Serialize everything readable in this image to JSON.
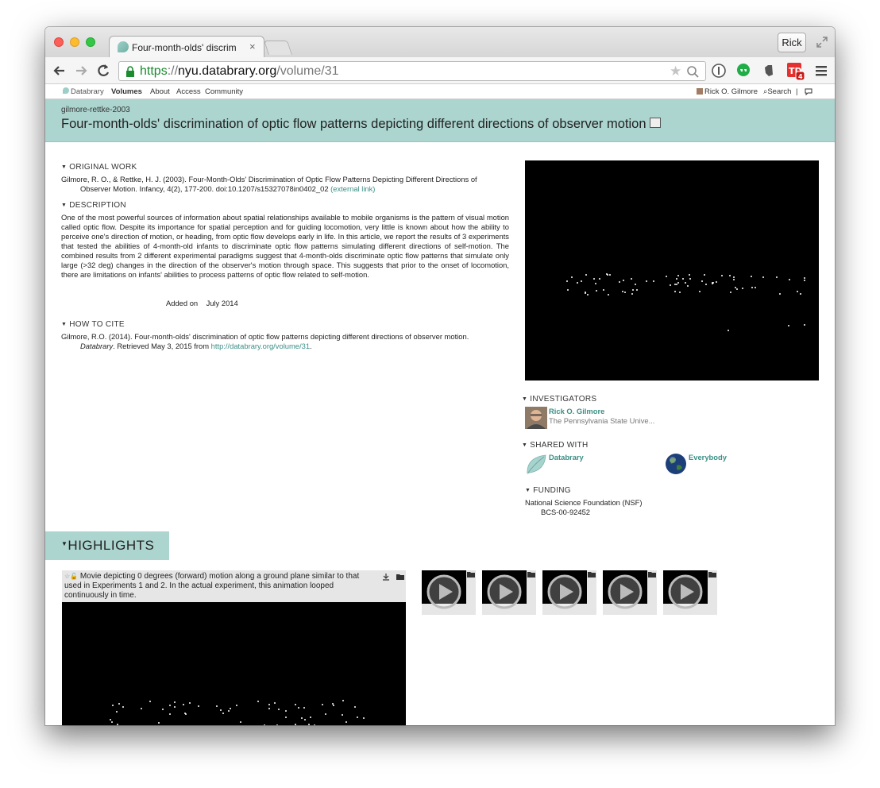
{
  "browser": {
    "tab_title": "Four-month-olds' discrim",
    "tab_close": "×",
    "user_label": "Rick",
    "url_scheme": "https",
    "url_sep": "://",
    "url_host": "nyu.databrary.org",
    "url_path": "/volume/31",
    "badge_count": "4",
    "ext_td_label": "TD"
  },
  "sitenav": {
    "logo": "Databrary",
    "items": [
      "Volumes",
      "About",
      "Access",
      "Community"
    ],
    "user": "Rick O. Gilmore",
    "search": "Search",
    "separator": "|"
  },
  "volume": {
    "slug": "gilmore-rettke-2003",
    "title": "Four-month-olds' discrimination of optic flow patterns depicting different directions of observer motion"
  },
  "original_work": {
    "heading": "ORIGINAL WORK",
    "citation_line1": "Gilmore, R. O., & Rettke, H. J. (2003). Four-Month-Olds' Discrimination of Optic Flow Patterns Depicting Different Directions of",
    "citation_line2": "Observer Motion. Infancy, 4(2), 177-200. doi:10.1207/s15327078in0402_02",
    "external_link": "(external link)"
  },
  "description": {
    "heading": "DESCRIPTION",
    "text": "One of the most powerful sources of information about spatial relationships available to mobile organisms is the pattern of visual motion called optic flow. Despite its importance for spatial perception and for guiding locomotion, very little is known about how the ability to perceive one's direction of motion, or heading, from optic flow develops early in life. In this article, we report the results of 3 experiments that tested the abilities of 4-month-old infants to discriminate optic flow patterns simulating different directions of self-motion. The combined results from 2 different experimental paradigms suggest that 4-month-olds discriminate optic flow patterns that simulate only large (>32 deg) changes in the direction of the observer's motion through space. This suggests that prior to the onset of locomotion, there are limitations on infants' abilities to process patterns of optic flow related to self-motion.",
    "added_label": "Added on",
    "added_value": "July 2014"
  },
  "how_to_cite": {
    "heading": "HOW TO CITE",
    "line1": "Gilmore, R.O. (2014). Four-month-olds' discrimination of optic flow patterns depicting different directions of observer motion.",
    "journal": "Databrary",
    "retrieved": ". Retrieved May 3, 2015 from ",
    "url": "http://databrary.org/volume/31",
    "end": "."
  },
  "investigators": {
    "heading": "INVESTIGATORS",
    "name": "Rick O. Gilmore",
    "affiliation": "The Pennsylvania State Unive..."
  },
  "shared_with": {
    "heading": "SHARED WITH",
    "groups": [
      "Databrary",
      "Everybody"
    ]
  },
  "funding": {
    "heading": "FUNDING",
    "agency": "National Science Foundation (NSF)",
    "grant": "BCS-00-92452"
  },
  "highlights": {
    "heading": "HIGHLIGHTS",
    "caption": "Movie depicting 0 degrees (forward) motion along a ground plane similar to that used in Experiments 1 and 2. In the actual experiment, this animation looped continuously in time.",
    "thumb_count": 5
  },
  "colors": {
    "accent": "#acd5d0",
    "link": "#3a8f86",
    "url_green": "#1a8b2e"
  },
  "icons": [
    "lock-icon",
    "star-icon",
    "zoom-icon",
    "back-icon",
    "forward-icon",
    "reload-icon",
    "menu-icon",
    "edit-icon",
    "play-icon",
    "folder-icon",
    "download-icon"
  ]
}
